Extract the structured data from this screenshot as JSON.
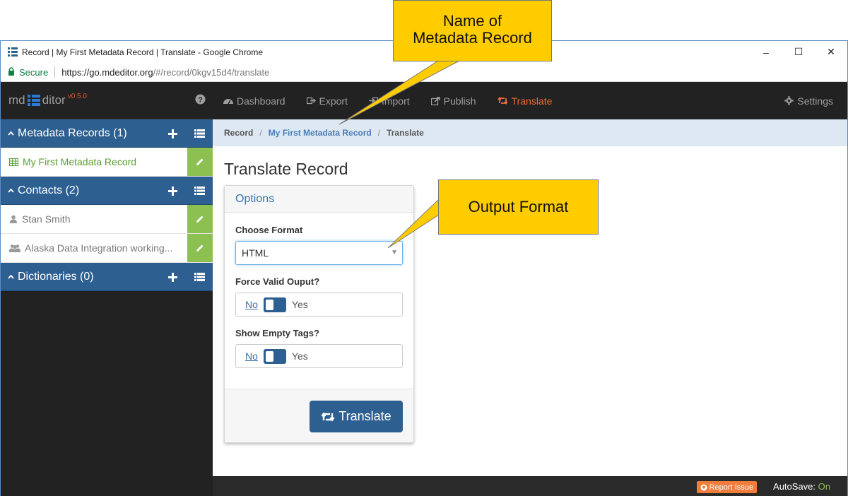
{
  "browser": {
    "title": "Record | My First Metadata Record | Translate - Google Chrome",
    "secure_label": "Secure",
    "url_host": "https://go.mdeditor.org",
    "url_path": "/#/record/0kgv15d4/translate",
    "controls": {
      "minimize": "–",
      "maximize": "☐",
      "close": "✕"
    }
  },
  "brand": {
    "prefix": "md",
    "suffix": "ditor",
    "version": "v0.5.0"
  },
  "sidebar": {
    "sections": [
      {
        "label": "Metadata Records (1)"
      },
      {
        "label": "Contacts (2)"
      },
      {
        "label": "Dictionaries (0)"
      }
    ],
    "records": [
      {
        "label": "My First Metadata Record"
      }
    ],
    "contacts": [
      {
        "label": "Stan Smith"
      },
      {
        "label": "Alaska Data Integration working..."
      }
    ]
  },
  "nav": {
    "items": [
      {
        "label": "Dashboard"
      },
      {
        "label": "Export"
      },
      {
        "label": "Import"
      },
      {
        "label": "Publish"
      },
      {
        "label": "Translate"
      }
    ],
    "settings": "Settings",
    "active_color": "#f26b3a"
  },
  "breadcrumb": {
    "root": "Record",
    "record": "My First Metadata Record",
    "current": "Translate",
    "divider": "/"
  },
  "page": {
    "title": "Translate Record"
  },
  "options": {
    "header": "Options",
    "format_label": "Choose Format",
    "format_value": "HTML",
    "force_label": "Force Valid Ouput?",
    "empty_label": "Show Empty Tags?",
    "no_label": "No",
    "yes_label": "Yes",
    "translate_button": "Translate"
  },
  "footer": {
    "report": "Report Issue",
    "autosave_label": "AutoSave:",
    "autosave_value": "On"
  },
  "callouts": {
    "record_name_line1": "Name of",
    "record_name_line2": "Metadata Record",
    "output_format": "Output Format"
  },
  "colors": {
    "accent": "#2d5f91",
    "success": "#8cc152",
    "callout": "#ffcc00"
  }
}
